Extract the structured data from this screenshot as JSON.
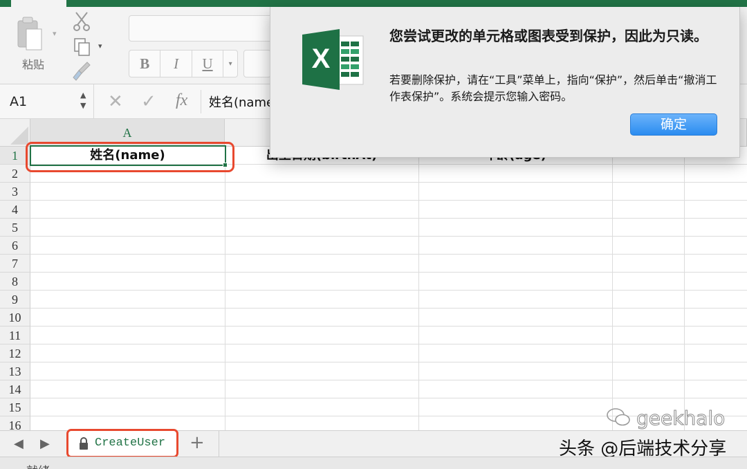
{
  "ribbon": {
    "paste_label": "粘贴",
    "format_buttons": [
      "B",
      "I",
      "U"
    ],
    "format_dropdown": "▾",
    "right_cut": "→"
  },
  "formula_bar": {
    "name_box": "A1",
    "stepper_up": "▲",
    "stepper_down": "▼",
    "cancel": "✕",
    "confirm": "✓",
    "fx": "fx",
    "formula": "姓名(name"
  },
  "grid": {
    "column_a": "A",
    "row_numbers": [
      "1",
      "2",
      "3",
      "4",
      "5",
      "6",
      "7",
      "8",
      "9",
      "10",
      "11",
      "12",
      "13",
      "14",
      "15",
      "16"
    ],
    "row1_cells": [
      "姓名(name)",
      "出生日期(birthAt)",
      "年龄(age)"
    ]
  },
  "sheets": {
    "prev": "◀",
    "next": "▶",
    "tab_label": "CreateUser",
    "add": "+"
  },
  "status": {
    "text": "就绪"
  },
  "dialog": {
    "title": "您尝试更改的单元格或图表受到保护，因此为只读。",
    "message": "若要删除保护，请在“工具”菜单上，指向“保护”，然后单击“撤消工作表保护”。系统会提示您输入密码。",
    "ok_label": "确定",
    "logo_letter": "X"
  },
  "watermark": {
    "handle": "geekhalo",
    "text": "头条 @后端技术分享"
  },
  "colors": {
    "excel_green": "#217346",
    "highlight_red": "#e8492f",
    "button_blue": "#2a8cf0"
  }
}
